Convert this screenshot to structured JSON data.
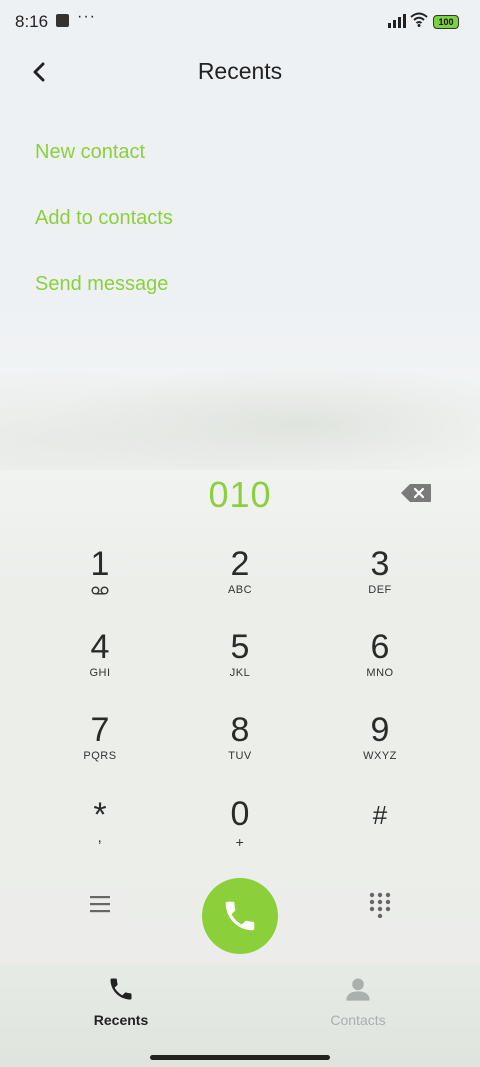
{
  "status_bar": {
    "time": "8:16",
    "dots": "···",
    "battery": "100"
  },
  "header": {
    "title": "Recents"
  },
  "menu": {
    "new_contact": "New contact",
    "add_to_contacts": "Add to contacts",
    "send_message": "Send message"
  },
  "dialer": {
    "number": "010",
    "keys": [
      {
        "num": "1",
        "sub": "voicemail-icon"
      },
      {
        "num": "2",
        "sub": "ABC"
      },
      {
        "num": "3",
        "sub": "DEF"
      },
      {
        "num": "4",
        "sub": "GHI"
      },
      {
        "num": "5",
        "sub": "JKL"
      },
      {
        "num": "6",
        "sub": "MNO"
      },
      {
        "num": "7",
        "sub": "PQRS"
      },
      {
        "num": "8",
        "sub": "TUV"
      },
      {
        "num": "9",
        "sub": "WXYZ"
      },
      {
        "num": "*",
        "sub": ","
      },
      {
        "num": "0",
        "sub": "+"
      },
      {
        "num": "#",
        "sub": ""
      }
    ]
  },
  "tabs": {
    "recents": "Recents",
    "contacts": "Contacts"
  },
  "colors": {
    "accent": "#8bd03a",
    "text": "#222222",
    "inactive": "#aab0ae"
  }
}
